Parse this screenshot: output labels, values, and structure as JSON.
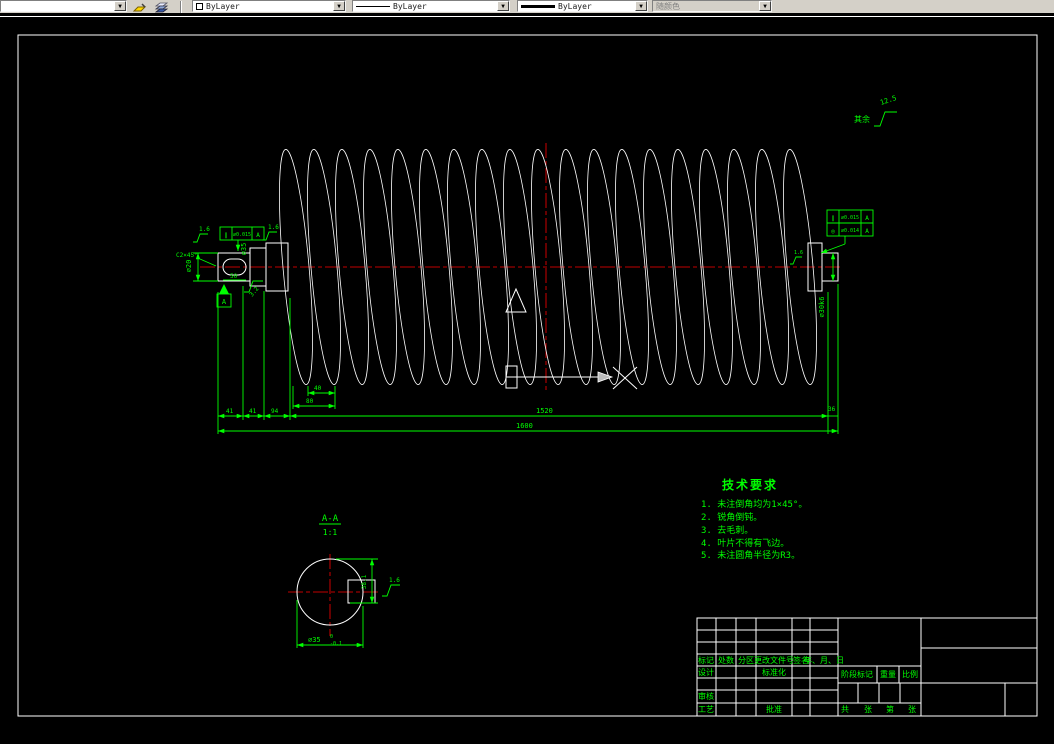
{
  "toolbar": {
    "color_value": "ByLayer",
    "linetype_value": "ByLayer",
    "lineweight_value": "ByLayer",
    "plotstyle_value": "随颜色"
  },
  "colors": {
    "annotation": "#00ff00",
    "centerline": "#ff0000",
    "geometry": "#ffffff",
    "section_hatch": "#00ffff",
    "toolbar_bg": "#d4d0c8"
  },
  "notes": {
    "rest_label": "其余",
    "rest_value": "12.5"
  },
  "tolerances": {
    "left": {
      "sym": "∥",
      "val": "⌀0.015",
      "datum": "A"
    },
    "right1": {
      "sym": "∥",
      "val": "⌀0.015",
      "datum": "A"
    },
    "right2": {
      "sym": "◎",
      "val": "⌀0.014",
      "datum": "A"
    },
    "datum_label": "A"
  },
  "dims": {
    "d41a": "41",
    "d41b": "41",
    "d94": "94",
    "d40": "40",
    "d80": "80",
    "span": "1520",
    "overall": "1600",
    "d36": "36",
    "key_len": "50",
    "dia_left": "⌀20",
    "dia_hub": "⌀35",
    "dia_right": "⌀30k6",
    "chamfer": "C2×45°",
    "r16": "1.6",
    "r32": "3.2"
  },
  "section": {
    "title": "A-A",
    "scale": "1:1",
    "width": "⌀35",
    "width_tol_hi": "0",
    "width_tol_lo": "-0.1",
    "depth": "38.1",
    "rough": "1.6"
  },
  "tech": {
    "title": "技术要求",
    "items": [
      "1. 未注倒角均为1×45°。",
      "2. 锐角倒钝。",
      "3. 去毛刺。",
      "4. 叶片不得有飞边。",
      "5. 未注圆角半径为R3。"
    ]
  },
  "titleblock": {
    "mark": "标记",
    "count": "处数",
    "zone": "分区",
    "change_no": "更改文件号",
    "sign": "签名",
    "date": "年、月、日",
    "design": "设计",
    "standardize": "标准化",
    "review": "审核",
    "process": "工艺",
    "approve": "批准",
    "stage": "阶段标记",
    "weight": "重量",
    "scale": "比例",
    "total": "共",
    "sheet_a": "张",
    "no": "第",
    "sheet_b": "张"
  }
}
